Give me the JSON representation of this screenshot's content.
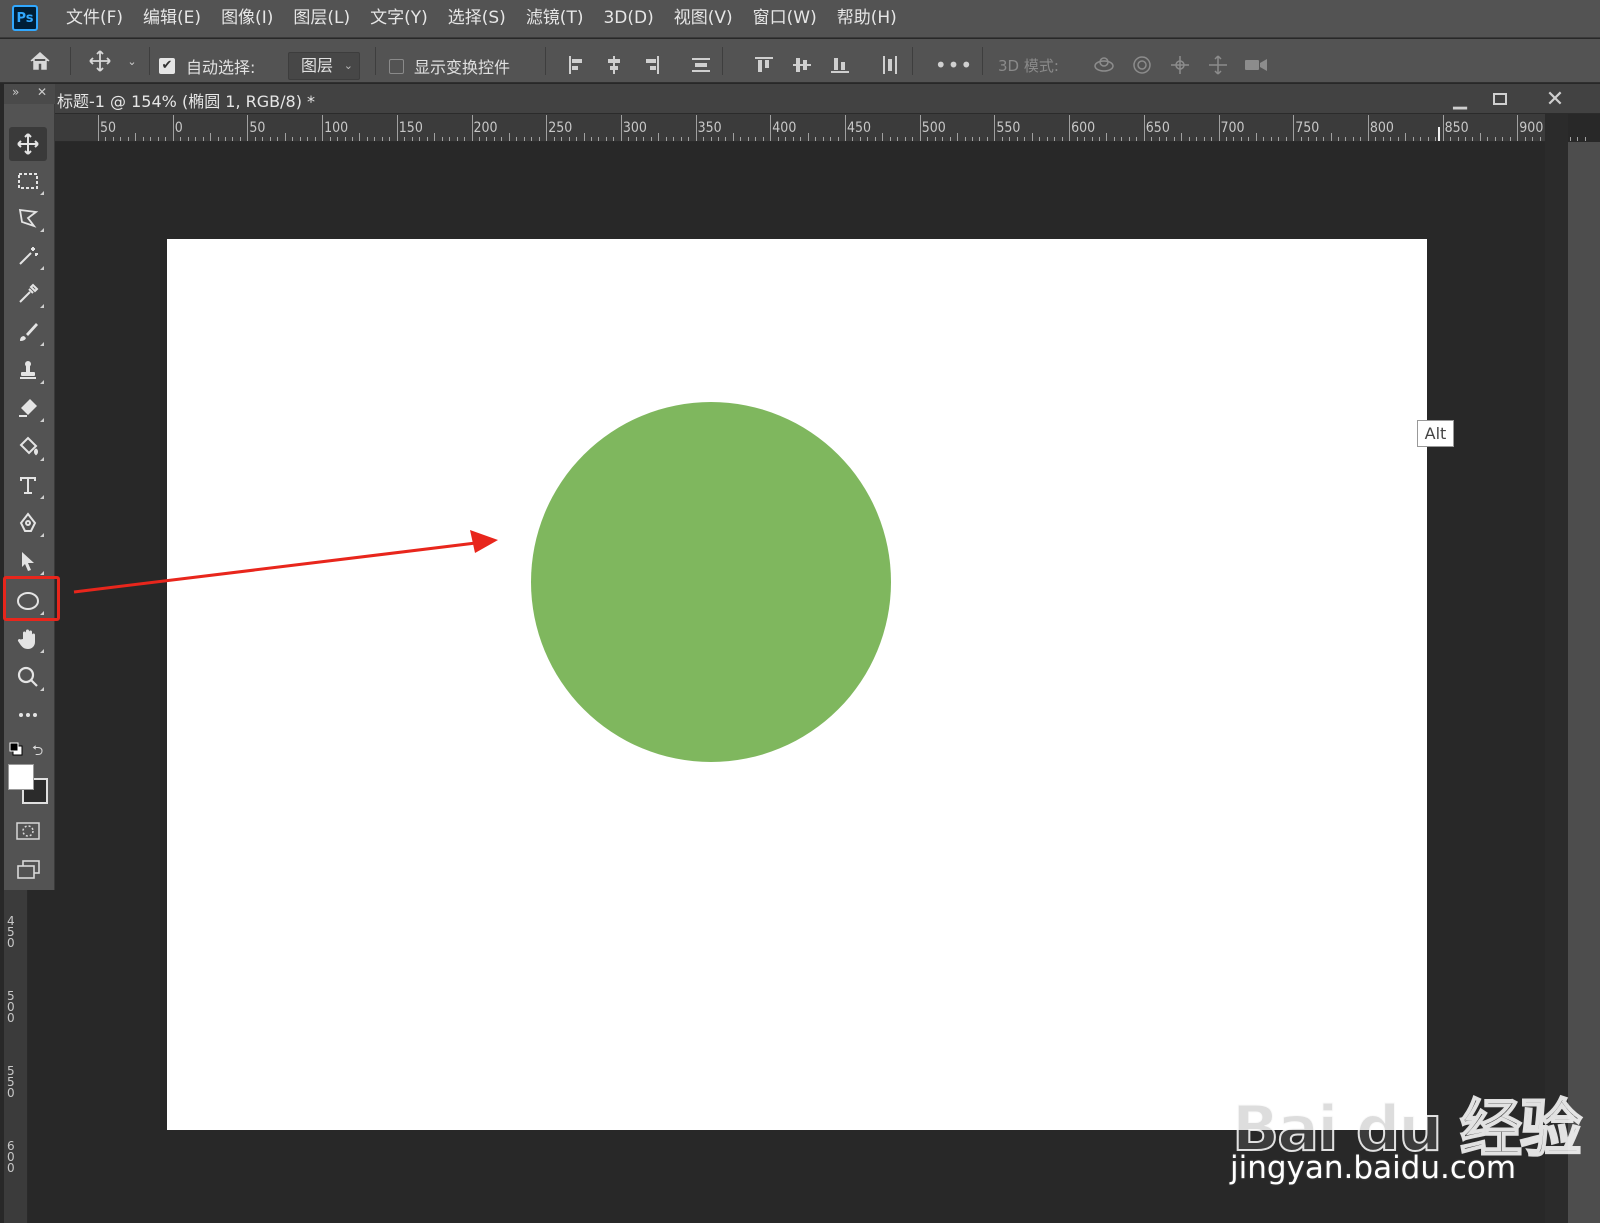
{
  "app": {
    "logo_text": "Ps"
  },
  "menu": [
    "文件(F)",
    "编辑(E)",
    "图像(I)",
    "图层(L)",
    "文字(Y)",
    "选择(S)",
    "滤镜(T)",
    "3D(D)",
    "视图(V)",
    "窗口(W)",
    "帮助(H)"
  ],
  "options_bar": {
    "auto_select_label": "自动选择:",
    "auto_select_checked": true,
    "layer_select_value": "图层",
    "show_transform_label": "显示变换控件",
    "show_transform_checked": false,
    "mode_3d_label": "3D 模式:"
  },
  "document": {
    "tab_title": "标题-1 @ 154% (椭圆 1, RGB/8) *"
  },
  "ruler_top_labels": [
    "50",
    "0",
    "50",
    "100",
    "150",
    "200",
    "250",
    "300",
    "350",
    "400",
    "450",
    "500",
    "550",
    "600",
    "650",
    "700",
    "750",
    "800",
    "850",
    "900"
  ],
  "ruler_left_labels": [
    "450",
    "500",
    "550",
    "600"
  ],
  "tools": [
    {
      "name": "move-tool",
      "icon": "move-icon"
    },
    {
      "name": "rect-marquee-tool",
      "icon": "marquee-icon"
    },
    {
      "name": "lasso-tool",
      "icon": "polygon-lasso-icon"
    },
    {
      "name": "magic-wand-tool",
      "icon": "magic-wand-icon"
    },
    {
      "name": "eyedropper-tool",
      "icon": "eyedropper-icon"
    },
    {
      "name": "brush-tool",
      "icon": "brush-icon"
    },
    {
      "name": "stamp-tool",
      "icon": "stamp-icon"
    },
    {
      "name": "eraser-tool",
      "icon": "eraser-icon"
    },
    {
      "name": "paint-bucket-tool",
      "icon": "bucket-icon"
    },
    {
      "name": "type-tool",
      "icon": "type-icon"
    },
    {
      "name": "pen-tool",
      "icon": "pen-icon"
    },
    {
      "name": "path-select-tool",
      "icon": "arrow-icon"
    },
    {
      "name": "ellipse-tool",
      "icon": "ellipse-icon"
    },
    {
      "name": "hand-tool",
      "icon": "hand-icon"
    },
    {
      "name": "zoom-tool",
      "icon": "zoom-icon"
    },
    {
      "name": "more-tools",
      "icon": "ellipsis-icon"
    }
  ],
  "shape": {
    "type": "circle",
    "color": "#7fb75e"
  },
  "colors": {
    "foreground": "#ffffff",
    "background": "#2b2b2b",
    "annotation": "#e8261c"
  },
  "tooltip": {
    "text": "Alt"
  },
  "watermark": {
    "brand": "Bai du 经验",
    "url": "jingyan.baidu.com"
  }
}
